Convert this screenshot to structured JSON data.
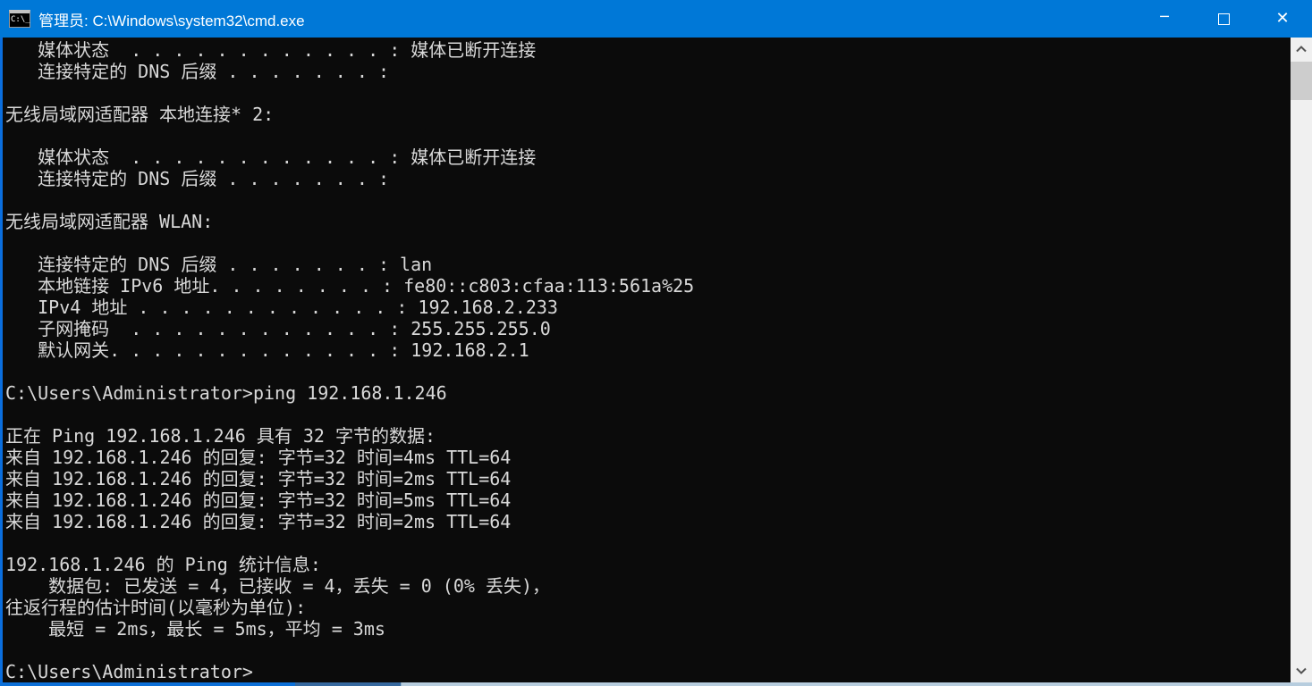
{
  "window": {
    "title": "管理员: C:\\Windows\\system32\\cmd.exe",
    "icon_text": "C:\\_",
    "controls": {
      "minimize": "─",
      "maximize": "□",
      "close": "✕"
    }
  },
  "terminal": {
    "prompt": "C:\\Users\\Administrator>",
    "lines": [
      "   媒体状态  . . . . . . . . . . . . : 媒体已断开连接",
      "   连接特定的 DNS 后缀 . . . . . . . :",
      "",
      "无线局域网适配器 本地连接* 2:",
      "",
      "   媒体状态  . . . . . . . . . . . . : 媒体已断开连接",
      "   连接特定的 DNS 后缀 . . . . . . . :",
      "",
      "无线局域网适配器 WLAN:",
      "",
      "   连接特定的 DNS 后缀 . . . . . . . : lan",
      "   本地链接 IPv6 地址. . . . . . . . : fe80::c803:cfaa:113:561a%25",
      "   IPv4 地址 . . . . . . . . . . . . : 192.168.2.233",
      "   子网掩码  . . . . . . . . . . . . : 255.255.255.0",
      "   默认网关. . . . . . . . . . . . . : 192.168.2.1",
      "",
      "C:\\Users\\Administrator>ping 192.168.1.246",
      "",
      "正在 Ping 192.168.1.246 具有 32 字节的数据:",
      "来自 192.168.1.246 的回复: 字节=32 时间=4ms TTL=64",
      "来自 192.168.1.246 的回复: 字节=32 时间=2ms TTL=64",
      "来自 192.168.1.246 的回复: 字节=32 时间=5ms TTL=64",
      "来自 192.168.1.246 的回复: 字节=32 时间=2ms TTL=64",
      "",
      "192.168.1.246 的 Ping 统计信息:",
      "    数据包: 已发送 = 4，已接收 = 4，丢失 = 0 (0% 丢失)，",
      "往返行程的估计时间(以毫秒为单位):",
      "    最短 = 2ms，最长 = 5ms，平均 = 3ms",
      "",
      "C:\\Users\\Administrator>"
    ]
  },
  "colors": {
    "titlebar": "#0078D7",
    "console_bg": "#0B0B0B",
    "console_text": "#D9D9D9",
    "window_border": "#0A6EDE",
    "scrollbar_track": "#F0F0F0",
    "scrollbar_thumb": "#CDCDCD",
    "scrollbar_arrow": "#555555"
  }
}
